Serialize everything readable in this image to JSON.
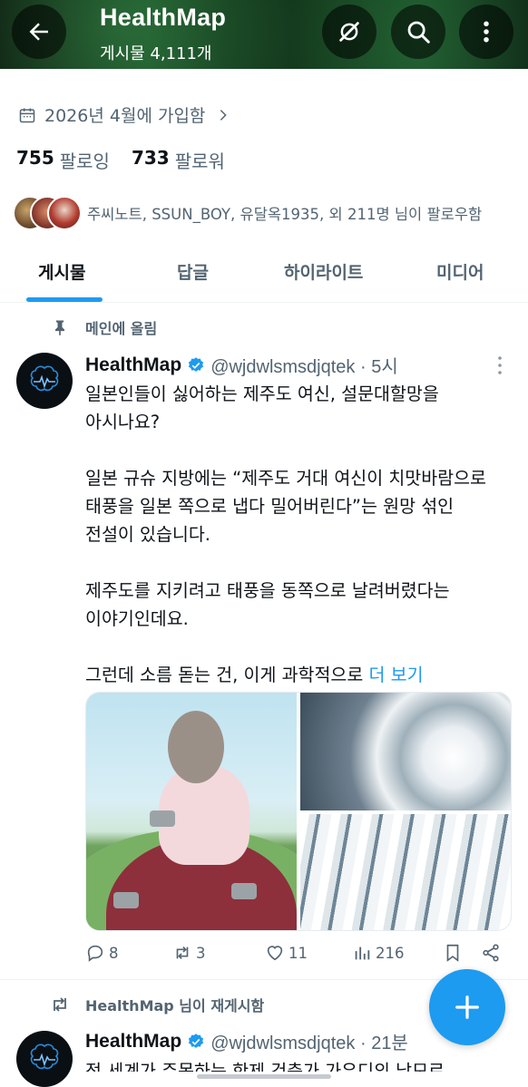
{
  "header": {
    "title": "HealthMap",
    "subtitle": "게시물 4,111개",
    "icons": [
      "back-arrow-icon",
      "no-notifications-icon",
      "search-icon",
      "more-vertical-icon"
    ]
  },
  "profile": {
    "joined": "2026년 4월에 가입함",
    "following_count": "755",
    "following_label": "팔로잉",
    "followers_count": "733",
    "followers_label": "팔로워",
    "known_followers": "주씨노트, SSUN_BOY, 유달옥1935, 외 211명 님이 팔로우함"
  },
  "tabs": [
    {
      "label": "게시물",
      "active": true
    },
    {
      "label": "답글",
      "active": false
    },
    {
      "label": "하이라이트",
      "active": false
    },
    {
      "label": "미디어",
      "active": false
    }
  ],
  "pinned_post": {
    "pinned_label": "메인에 올림",
    "author_name": "HealthMap",
    "handle_time": "@wjdwlsmsdjqtek · 5시",
    "body": [
      "일본인들이 싫어하는 제주도 여신, 설문대할망을",
      "아시나요?",
      "일본 규슈 지방에는 “제주도 거대 여신이 치맛바람으로",
      "태풍을 일본 쪽으로 냅다 밀어버린다”는 원망 섞인",
      "전설이 있습니다.",
      "제주도를 지키려고 태풍을 동쪽으로 날려버렸다는",
      "이야기인데요.",
      "그런데 소름 돋는 건, 이게 과학적으로 "
    ],
    "more_link": "더 보기",
    "replies": "8",
    "reposts": "3",
    "likes": "11",
    "views": "216"
  },
  "second_post": {
    "repost_label": "HealthMap 님이 재게시함",
    "author_name": "HealthMap",
    "handle_time": "@wjdwlsmsdjqtek · 21분",
    "preview": "전 세계가 주목하는 한제 건축가 가우디의 남모르"
  },
  "colors": {
    "accent": "#1d9bf0",
    "secondary_text": "#536471",
    "primary_text": "#0f1419"
  }
}
